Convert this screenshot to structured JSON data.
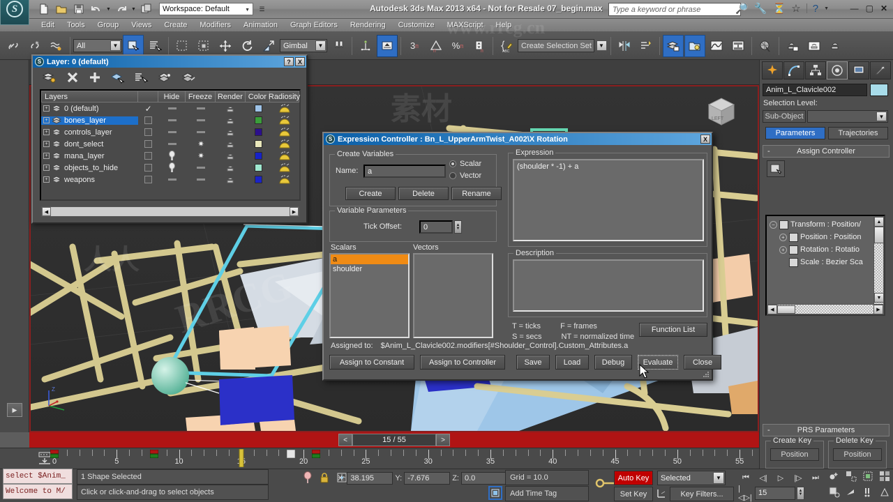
{
  "titlebar": {
    "workspace_label": "Workspace: Default",
    "app_title": "Autodesk 3ds Max  2013 x64  - Not for Resale   07_begin.max",
    "search_placeholder": "Type a keyword or phrase",
    "icons": [
      "new-icon",
      "open-icon",
      "save-icon",
      "undo-icon",
      "redo-icon",
      "project-icon"
    ],
    "right_icons": [
      "binoculars-icon",
      "wrench-icon",
      "subscription-icon",
      "star-icon",
      "help-icon"
    ],
    "window_controls": [
      "minimize",
      "maximize",
      "close"
    ]
  },
  "menubar": {
    "items": [
      "Edit",
      "Tools",
      "Group",
      "Views",
      "Create",
      "Modifiers",
      "Animation",
      "Graph Editors",
      "Rendering",
      "Customize",
      "MAXScript",
      "Help"
    ]
  },
  "toolbar": {
    "selection_filter": "All",
    "reference_coord": "Gimbal",
    "named_selection_set": "Create Selection Set",
    "snap_value": "3"
  },
  "viewport": {
    "label": "",
    "axis_labels": [
      "Z",
      "Y",
      "X"
    ],
    "nav_cube_label": "LEFT"
  },
  "timeslider": {
    "current": "15 / 55",
    "prev": "<",
    "next": ">"
  },
  "trackbar": {
    "ruler_labels": [
      "0",
      "5",
      "10",
      "15",
      "20",
      "25",
      "30",
      "35",
      "40",
      "45",
      "50",
      "55"
    ],
    "ruler_values": [
      0,
      5,
      10,
      15,
      20,
      25,
      30,
      35,
      40,
      45,
      50,
      55
    ],
    "keys": [
      0,
      8,
      15,
      19,
      21
    ]
  },
  "statusbar": {
    "listener_line1": "select $Anim_",
    "listener_line2": "Welcome to M/",
    "selection_status": "1 Shape Selected",
    "prompt": "Click or click-and-drag to select objects",
    "coord_x_label": "X:",
    "coord_x": "38.195",
    "coord_y_label": "Y:",
    "coord_y": "-7.676",
    "coord_z_label": "Z:",
    "coord_z": "0.0",
    "grid": "Grid = 10.0",
    "time_tag": "Add Time Tag",
    "auto_key": "Auto Key",
    "set_key": "Set Key",
    "key_mode": "Selected",
    "key_filters": "Key Filters...",
    "current_frame": "15"
  },
  "command_panel": {
    "tabs": [
      "create-tab",
      "modify-tab",
      "hierarchy-tab",
      "motion-tab",
      "display-tab",
      "utilities-tab"
    ],
    "active_tab_index": 3,
    "object_name": "Anim_L_Clavicle002",
    "object_color": "#a8dcea",
    "selection_level_label": "Selection Level:",
    "sub_object": "Sub-Object",
    "sub_object_value": "",
    "motion_tabs": [
      {
        "label": "Parameters",
        "selected": true
      },
      {
        "label": "Trajectories",
        "selected": false
      }
    ],
    "rollouts": [
      {
        "label": "Assign Controller",
        "expanded": true
      },
      {
        "label": "PRS Parameters",
        "expanded": true
      }
    ],
    "controller_tree": [
      {
        "label": "Transform : Position/",
        "indent": 0,
        "expander": "minus"
      },
      {
        "label": "Position : Position",
        "indent": 1,
        "expander": "plus"
      },
      {
        "label": "Rotation : Rotatio",
        "indent": 1,
        "expander": "plus"
      },
      {
        "label": "Scale : Bezier Sca",
        "indent": 1,
        "expander": "none"
      }
    ],
    "prs": {
      "create_key_label": "Create Key",
      "delete_key_label": "Delete Key",
      "create_position": "Position",
      "delete_position": "Position"
    }
  },
  "layer_dialog": {
    "title": "Layer: 0 (default)",
    "help_btn": "?",
    "close_btn": "X",
    "toolbar_icons": [
      "create-new-layer-icon",
      "delete-layer-icon",
      "add-selection-icon",
      "select-highlighted-icon",
      "select-objects-icon",
      "highlight-selected-icon",
      "hide-unhide-icon"
    ],
    "columns": [
      "Layers",
      "",
      "Hide",
      "Freeze",
      "Render",
      "Color",
      "Radiosity"
    ],
    "rows": [
      {
        "name": "0 (default)",
        "current": true,
        "selected": false,
        "hide": "dash",
        "freeze": "dash",
        "color": "#9ec3e8"
      },
      {
        "name": "bones_layer",
        "current": false,
        "selected": true,
        "hide": "dash",
        "freeze": "dash",
        "color": "#3a9e3a"
      },
      {
        "name": "controls_layer",
        "current": false,
        "selected": false,
        "hide": "dash",
        "freeze": "dash",
        "color": "#2c0f8c"
      },
      {
        "name": "dont_select",
        "current": false,
        "selected": false,
        "hide": "dash",
        "freeze": "snow",
        "color": "#e9e7bb"
      },
      {
        "name": "mana_layer",
        "current": false,
        "selected": false,
        "hide": "bulb",
        "freeze": "snow",
        "color": "#1622c8"
      },
      {
        "name": "objects_to_hide",
        "current": false,
        "selected": false,
        "hide": "bulb",
        "freeze": "dash",
        "color": "#9fe8d0"
      },
      {
        "name": "weapons",
        "current": false,
        "selected": false,
        "hide": "dash",
        "freeze": "dash",
        "color": "#1b23c6"
      }
    ]
  },
  "expression_dialog": {
    "title": "Expression Controller : Bn_L_UpperArmTwist_A002\\X Rotation",
    "close_btn": "X",
    "groups": {
      "create_variables": "Create Variables",
      "variable_parameters": "Variable Parameters",
      "expression": "Expression",
      "description": "Description"
    },
    "name_label": "Name:",
    "name_value": "a",
    "type_options": [
      {
        "label": "Scalar",
        "selected": true
      },
      {
        "label": "Vector",
        "selected": false
      }
    ],
    "buttons_row1": [
      "Create",
      "Delete",
      "Rename"
    ],
    "tick_offset_label": "Tick Offset:",
    "tick_offset_value": "0",
    "scalars_label": "Scalars",
    "vectors_label": "Vectors",
    "scalars": [
      {
        "name": "a",
        "selected": true
      },
      {
        "name": "shoulder",
        "selected": false
      }
    ],
    "vectors": [],
    "expression_text": "(shoulder * -1) + a",
    "description_text": "",
    "legend": [
      "T = ticks",
      "F = frames",
      "S = secs",
      "NT = normalized time"
    ],
    "function_list_btn": "Function List",
    "assigned_to_label": "Assigned to:",
    "assigned_to_value": "$Anim_L_Clavicle002.modifiers[#Shoulder_Control].Custom_Attributes.a",
    "bottom_buttons": [
      "Assign to Constant",
      "Assign to Controller",
      "Save",
      "Load",
      "Debug",
      "Evaluate",
      "Close"
    ],
    "focused_button": "Evaluate"
  },
  "colors": {
    "accent_blue": "#2f6ec4",
    "highlight_orange": "#f08b14",
    "autokey_red": "#c00000",
    "timeslider_red": "#b01414",
    "viewport_border": "#8a2020",
    "panel_gray": "#4e4e4e"
  },
  "watermarks": [
    "RRCG",
    "素材",
    "人人素材",
    "www.rrcg.cn"
  ]
}
